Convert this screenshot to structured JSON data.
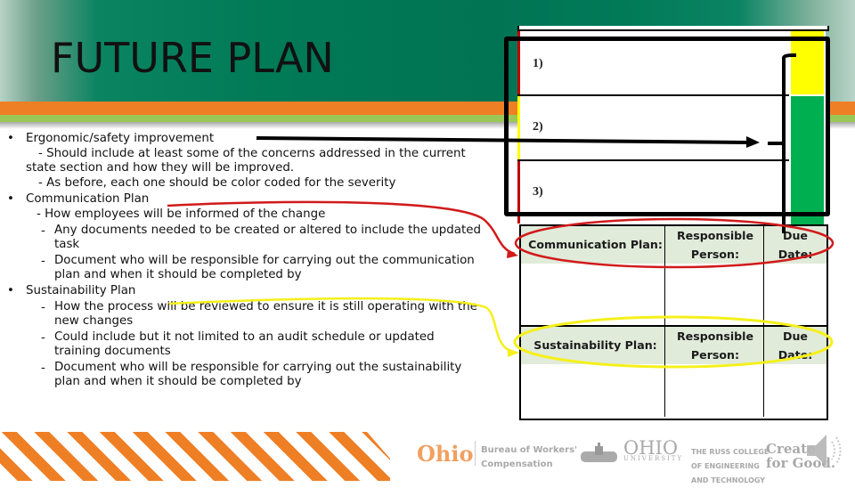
{
  "slide": {
    "title": "FUTURE PLAN",
    "colors": {
      "header_green": "#017a56",
      "stripe_orange": "#ef7f25",
      "stripe_green": "#99c856",
      "annotation_red": "#d11a1a",
      "annotation_yellow": "#f5f01a",
      "severity_yellow": "#ffff00",
      "severity_green": "#00b050",
      "severity_red": "#c00000",
      "table_header_fill": "#e1ebda"
    }
  },
  "bullets": [
    {
      "bullet": "•",
      "label": "Ergonomic/safety improvement",
      "sub": [
        {
          "dash": "",
          "lines": [
            "- Should include at least some of the concerns addressed in the current",
            "state section and how they will be improved."
          ]
        },
        {
          "dash": "",
          "lines": [
            "- As before, each one should be color coded for the severity"
          ]
        }
      ]
    },
    {
      "bullet": "•",
      "label": "Communication Plan",
      "sub": [
        {
          "dash": "",
          "lines": [
            "- How employees will be informed of the change"
          ]
        },
        {
          "dash": "-",
          "lines": [
            "Any documents needed to be created or altered to include the updated",
            "task"
          ]
        },
        {
          "dash": "-",
          "lines": [
            "Document who will be responsible for carrying out the communication",
            "plan and when it should be completed by"
          ]
        }
      ]
    },
    {
      "bullet": "•",
      "label": "Sustainability Plan",
      "sub": [
        {
          "dash": "-",
          "lines": [
            "How the process will be reviewed to ensure it is still operating with the",
            "new changes"
          ]
        },
        {
          "dash": "-",
          "lines": [
            "Could include but it not limited to an audit schedule or updated",
            "training documents"
          ]
        },
        {
          "dash": "-",
          "lines": [
            "Document who will be responsible for carrying out the sustainability",
            "plan and when it should be completed by"
          ]
        }
      ]
    }
  ],
  "improvement_table": {
    "rows": [
      {
        "label": "1)",
        "severity": "yellow"
      },
      {
        "label": "2)",
        "severity": "green"
      },
      {
        "label": "3)",
        "severity": "green"
      }
    ]
  },
  "communication_table": {
    "headers": [
      "Communication Plan:",
      [
        "Responsible",
        "Person:"
      ],
      [
        "Due",
        "Date:"
      ]
    ]
  },
  "sustainability_table": {
    "headers": [
      "Sustainability Plan:",
      [
        "Responsible",
        "Person:"
      ],
      [
        "Due",
        "Date:"
      ]
    ]
  },
  "footer": {
    "logos": [
      {
        "name": "Ohio",
        "text": "Ohio",
        "subtitle": [
          "Bureau of Workers'",
          "Compensation"
        ]
      },
      {
        "name": "Ohio University",
        "text": "OHIO",
        "subtitle": [
          "UNIVERSITY"
        ]
      },
      {
        "name": "Russ College",
        "lines": [
          "THE RUSS COLLEGE",
          "OF ENGINEERING",
          "AND TECHNOLOGY"
        ]
      },
      {
        "name": "Create for Good",
        "lines": [
          "Create",
          "for Good."
        ]
      }
    ],
    "audio_icon": "speaker-icon"
  }
}
